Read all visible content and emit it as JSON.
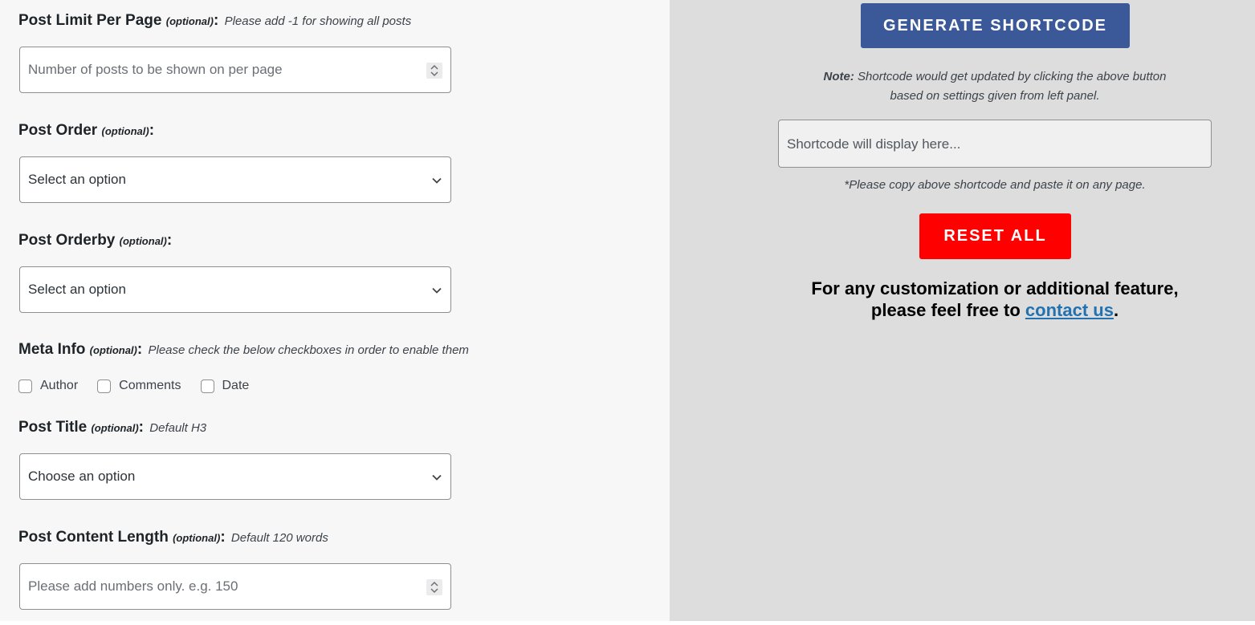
{
  "fields": {
    "post_limit": {
      "label": "Post Limit Per Page",
      "optional": "(optional)",
      "colon": ":",
      "hint": "Please add -1 for showing all posts",
      "placeholder": "Number of posts to be shown on per page"
    },
    "post_order": {
      "label": "Post Order",
      "optional": "(optional)",
      "colon": ":",
      "selected": "Select an option"
    },
    "post_orderby": {
      "label": "Post Orderby",
      "optional": "(optional)",
      "colon": ":",
      "selected": "Select an option"
    },
    "meta_info": {
      "label": "Meta Info",
      "optional": "(optional)",
      "colon": ":",
      "hint": "Please check the below checkboxes in order to enable them",
      "checkboxes": [
        {
          "label": "Author",
          "checked": false
        },
        {
          "label": "Comments",
          "checked": false
        },
        {
          "label": "Date",
          "checked": false
        }
      ]
    },
    "post_title": {
      "label": "Post Title",
      "optional": "(optional)",
      "colon": ":",
      "hint": "Default H3",
      "selected": "Choose an option"
    },
    "post_content_length": {
      "label": "Post Content Length",
      "optional": "(optional)",
      "colon": ":",
      "hint": "Default 120 words",
      "placeholder": "Please add numbers only. e.g. 150"
    }
  },
  "right": {
    "generate_label": "GENERATE SHORTCODE",
    "note_prefix": "Note:",
    "note_line1": "Shortcode would get updated by clicking the above button",
    "note_line2": "based on settings given from left panel.",
    "shortcode_placeholder": "Shortcode will display here...",
    "copy_note": "*Please copy above shortcode and paste it on any page.",
    "reset_label": "RESET ALL",
    "custom_line1": "For any customization or additional feature,",
    "custom_line2_prefix": "please feel free to",
    "contact_link": "contact us",
    "custom_line2_suffix": "."
  },
  "colors": {
    "generate_button": "#3b5998",
    "reset_button": "#ff0000",
    "left_bg": "#f7f7f7",
    "right_bg": "#dddddd",
    "link": "#2271b1"
  }
}
